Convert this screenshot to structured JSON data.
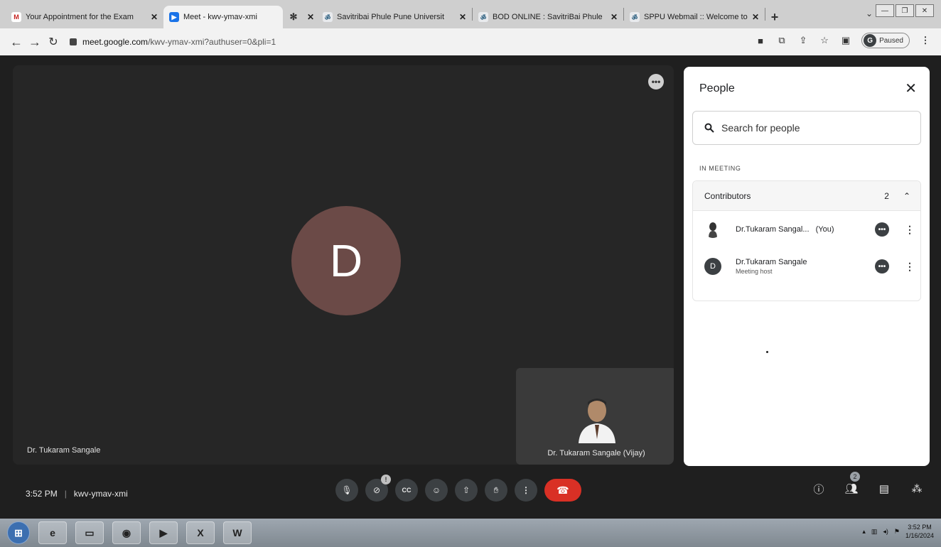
{
  "browser": {
    "tabs": [
      {
        "label": "Your Appointment for the Exam",
        "favicon": "M",
        "active": false
      },
      {
        "label": "Meet - kwv-ymav-xmi",
        "favicon": "meet",
        "active": true
      },
      {
        "label": "",
        "favicon": "gear",
        "active": false
      },
      {
        "label": "Savitribai Phule Pune Universit",
        "favicon": "sppu",
        "active": false
      },
      {
        "label": "BOD ONLINE : SavitriBai Phule",
        "favicon": "sppu",
        "active": false
      },
      {
        "label": "SPPU Webmail :: Welcome to",
        "favicon": "sppu",
        "active": false
      }
    ],
    "new_tab": "+",
    "url_domain": "meet.google.com",
    "url_path": "/kwv-ymav-xmi?authuser=0&pli=1",
    "profile_initial": "G",
    "profile_status": "Paused"
  },
  "meet": {
    "main_tile": {
      "avatar_letter": "D",
      "name": "Dr. Tukaram Sangale",
      "avatar_color": "#6b4a47"
    },
    "self_tile": {
      "name": "Dr. Tukaram Sangale (Vijay)"
    },
    "people_panel": {
      "title": "People",
      "search_placeholder": "Search for people",
      "section_label": "IN MEETING",
      "group_label": "Contributors",
      "group_count": "2",
      "participants": [
        {
          "name": "Dr.Tukaram Sangal...",
          "suffix": "(You)",
          "role": "",
          "avatar": "photo"
        },
        {
          "name": "Dr.Tukaram Sangale",
          "suffix": "",
          "role": "Meeting host",
          "avatar": "D"
        }
      ]
    },
    "bottom_bar": {
      "time": "3:52 PM",
      "meeting_code": "kwv-ymav-xmi",
      "camera_badge": "!",
      "people_badge": "2"
    },
    "end_call_color": "#d93025"
  },
  "taskbar": {
    "clock_time": "3:52 PM",
    "clock_date": "1/16/2024"
  }
}
